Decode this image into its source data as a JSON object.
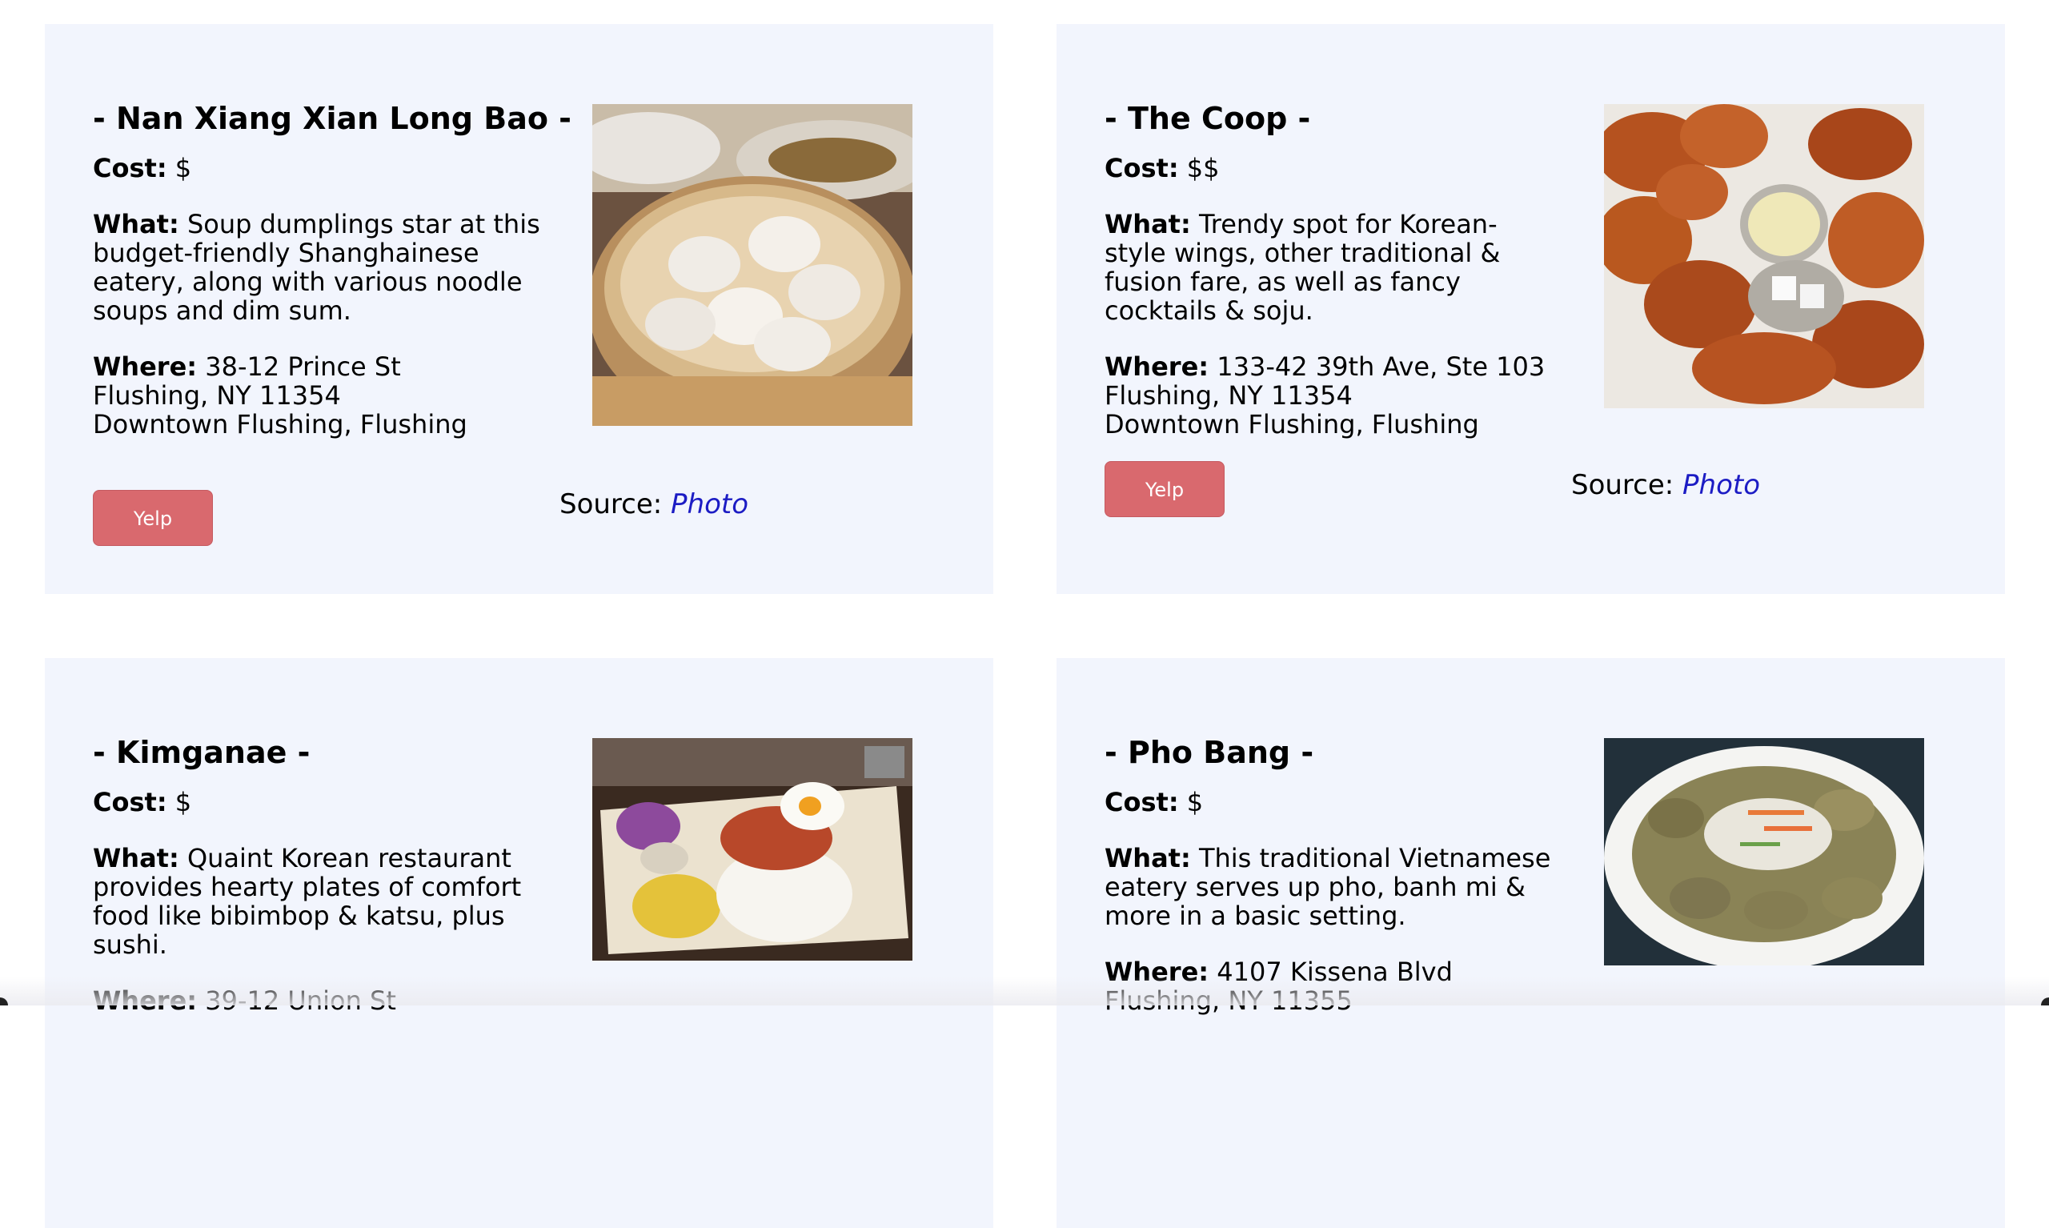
{
  "cards": [
    {
      "name": "- Nan Xiang Xian Long Bao -",
      "cost_label": "Cost:",
      "cost": "$",
      "what_label": "What:",
      "what": "Soup dumplings star at this budget-friendly Shanghainese eatery, along with various noodle soups and dim sum.",
      "where_label": "Where:",
      "where_lines": [
        "38-12 Prince St",
        "Flushing, NY 11354",
        "Downtown Flushing, Flushing"
      ],
      "yelp_label": "Yelp",
      "source_label": "Source:",
      "source_link": "Photo",
      "photo_alt": "soup-dumplings-photo"
    },
    {
      "name": "- The Coop -",
      "cost_label": "Cost:",
      "cost": "$$",
      "what_label": "What:",
      "what": "Trendy spot for Korean-style wings, other traditional & fusion fare, as well as fancy cocktails & soju.",
      "where_label": "Where:",
      "where_lines": [
        "133-42 39th Ave, Ste 103",
        "Flushing, NY 11354",
        "Downtown Flushing, Flushing"
      ],
      "yelp_label": "Yelp",
      "source_label": "Source:",
      "source_link": "Photo",
      "photo_alt": "fried-wings-photo"
    },
    {
      "name": "- Kimganae -",
      "cost_label": "Cost:",
      "cost": "$",
      "what_label": "What:",
      "what": "Quaint Korean restaurant provides hearty plates of comfort food like bibimbop & katsu, plus sushi.",
      "where_label": "Where:",
      "where_lines": [
        "39-12 Union St"
      ],
      "photo_alt": "rice-plate-photo"
    },
    {
      "name": "- Pho Bang -",
      "cost_label": "Cost:",
      "cost": "$",
      "what_label": "What:",
      "what": "This traditional Vietnamese eatery serves up pho, banh mi & more in a basic setting.",
      "where_label": "Where:",
      "where_lines": [
        "4107 Kissena Blvd",
        "Flushing, NY 11355"
      ],
      "photo_alt": "spring-roll-bowl-photo"
    }
  ],
  "colors": {
    "card_bg": "#f2f5fd",
    "yelp_button": "#d9696e",
    "link": "#1c1cc4"
  }
}
